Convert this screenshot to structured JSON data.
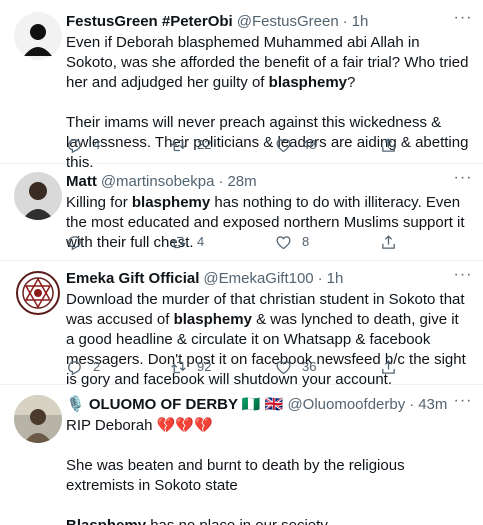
{
  "tweets": [
    {
      "name": "FestusGreen #PeterObi",
      "handle": "@FestusGreen",
      "dot": "·",
      "time": "1h",
      "text_parts": [
        {
          "t": "Even if Deborah blasphemed Muhammed abi Allah in Sokoto, was she afforded the benefit of a fair trial? Who tried her and adjudged her guilty of ",
          "b": false
        },
        {
          "t": "blasphemy",
          "b": true
        },
        {
          "t": "?\n\nTheir imams will never preach against this wickedness & lawlessness. Their politicians & leaders are aiding & abetting this.",
          "b": false
        }
      ],
      "replies": "4",
      "retweets": "22",
      "likes": "48"
    },
    {
      "name": "Matt",
      "handle": "@martinsobekpa",
      "dot": "·",
      "time": "28m",
      "text_parts": [
        {
          "t": "Killing for ",
          "b": false
        },
        {
          "t": "blasphemy",
          "b": true
        },
        {
          "t": " has nothing to do with illiteracy. Even the most educated and exposed northern Muslims support it with their full chest.",
          "b": false
        }
      ],
      "replies": "",
      "retweets": "4",
      "likes": "8"
    },
    {
      "name": "Emeka Gift Official",
      "handle": "@EmekaGift100",
      "dot": "·",
      "time": "1h",
      "text_parts": [
        {
          "t": "Download the murder of that christian student in Sokoto that was accused of ",
          "b": false
        },
        {
          "t": "blasphemy",
          "b": true
        },
        {
          "t": " & was lynched to death, give it a good headline & circulate it on Whatsapp & facebook messagers. Don't post it on facebook newsfeed b/c the sight is gory and facebook will shutdown your account.",
          "b": false
        }
      ],
      "replies": "2",
      "retweets": "92",
      "likes": "36"
    },
    {
      "name": "🎙️ OLUOMO OF DERBY 🇳🇬 🇬🇧",
      "handle": "@Oluomoofderby",
      "dot": "·",
      "time": "43m",
      "text_parts": [
        {
          "t": "RIP Deborah 💔💔💔\n\nShe was beaten and burnt to death by the religious extremists in Sokoto state\n\n",
          "b": false
        },
        {
          "t": "Blasphemy",
          "b": true
        },
        {
          "t": " has no place in our society.",
          "b": false
        }
      ]
    }
  ],
  "icons": {
    "reply": "reply-icon",
    "retweet": "retweet-icon",
    "like": "heart-icon",
    "more": "more-icon"
  },
  "colors": {
    "text": "#0f1419",
    "secondary": "#536471",
    "divider": "#eff3f4"
  }
}
